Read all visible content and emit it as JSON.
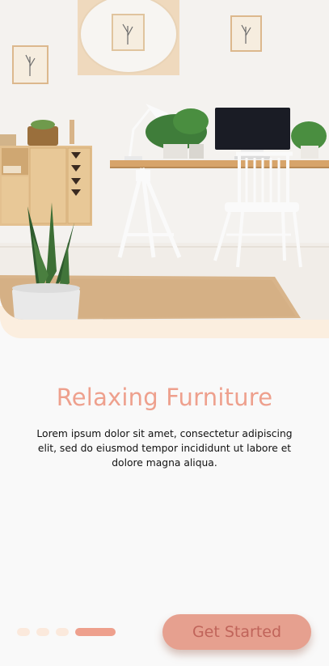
{
  "onboarding": {
    "title": "Relaxing Furniture",
    "description": "Lorem ipsum dolor sit amet, consectetur adipiscing elit, sed do eiusmod tempor incididunt ut labore et dolore magna aliqua.",
    "page_indicator": {
      "total": 4,
      "current": 4
    },
    "cta_label": "Get Started"
  },
  "colors": {
    "accent": "#eea08d",
    "button": "#e6a08f",
    "dot_inactive": "#fbe9dc",
    "hero_base": "#fbeedf"
  }
}
